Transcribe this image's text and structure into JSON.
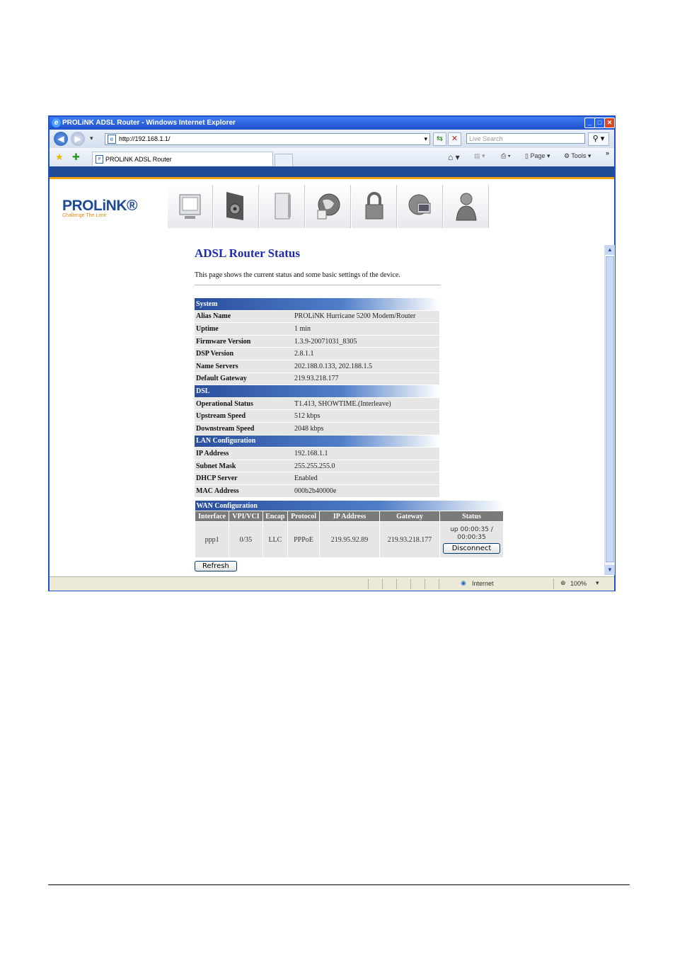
{
  "window": {
    "title": "PROLiNK ADSL Router - Windows Internet Explorer",
    "url": "http://192.168.1.1/",
    "search_placeholder": "Live Search",
    "tab_title": "PROLiNK ADSL Router",
    "toolbar": {
      "page_label": "Page",
      "tools_label": "Tools"
    },
    "status": {
      "zone": "Internet",
      "zoom": "100%"
    }
  },
  "header": {
    "logo_name": "PROLiNK®",
    "logo_tagline": "Challenge The Limit",
    "menu_icons": [
      "status-icon",
      "setup-icon",
      "device-icon",
      "internet-icon",
      "security-icon",
      "network-icon",
      "user-icon"
    ]
  },
  "main": {
    "title": "ADSL Router Status",
    "description": "This page shows the current status and some basic settings of the device.",
    "sections": [
      {
        "heading": "System",
        "rows": [
          {
            "label": "Alias Name",
            "value": "PROLiNK Hurricane 5200 Modem/Router"
          },
          {
            "label": "Uptime",
            "value": "1 min"
          },
          {
            "label": "Firmware Version",
            "value": "1.3.9-20071031_8305"
          },
          {
            "label": "DSP Version",
            "value": "2.8.1.1"
          },
          {
            "label": "Name Servers",
            "value": "202.188.0.133, 202.188.1.5"
          },
          {
            "label": "Default Gateway",
            "value": "219.93.218.177"
          }
        ]
      },
      {
        "heading": "DSL",
        "rows": [
          {
            "label": "Operational Status",
            "value": "T1.413, SHOWTIME.(Interleave)"
          },
          {
            "label": "Upstream Speed",
            "value": "512 kbps"
          },
          {
            "label": "Downstream Speed",
            "value": "2048 kbps"
          }
        ]
      },
      {
        "heading": "LAN Configuration",
        "rows": [
          {
            "label": "IP Address",
            "value": "192.168.1.1"
          },
          {
            "label": "Subnet Mask",
            "value": "255.255.255.0"
          },
          {
            "label": "DHCP Server",
            "value": "Enabled"
          },
          {
            "label": "MAC Address",
            "value": "000b2b40000e"
          }
        ]
      }
    ],
    "wan": {
      "heading": "WAN Configuration",
      "columns": [
        "Interface",
        "VPI/VCI",
        "Encap",
        "Protocol",
        "IP Address",
        "Gateway",
        "Status"
      ],
      "row": {
        "interface": "ppp1",
        "vpi_vci": "0/35",
        "encap": "LLC",
        "protocol": "PPPoE",
        "ip_address": "219.95.92.89",
        "gateway": "219.93.218.177",
        "status_text": "up 00:00:35 / 00:00:35",
        "disconnect_label": "Disconnect"
      }
    },
    "refresh_label": "Refresh"
  }
}
